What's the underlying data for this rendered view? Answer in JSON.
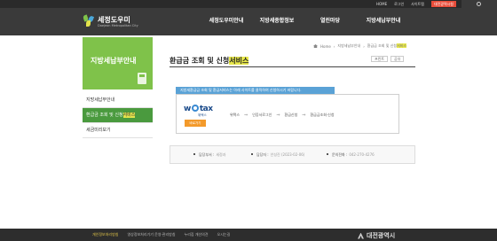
{
  "topbar": {
    "links": [
      "HOME",
      "로그인",
      "사이트맵",
      "대전광역시청"
    ]
  },
  "header": {
    "logo_ko": "세정도우미",
    "logo_en": "Daejeon Metropolitan City",
    "gnb": [
      "세정도우미안내",
      "지방세종합정보",
      "열린마당",
      "지방세납부안내"
    ]
  },
  "sidebar": {
    "title": "지방세납부안내",
    "items": [
      {
        "label": "지방세납부안내"
      },
      {
        "label": "환급금 조회 및 신청",
        "hl": "서비스"
      },
      {
        "label": "세금미리보기"
      }
    ]
  },
  "content": {
    "title": "환급금 조회 및 신청",
    "title_hl": "서비스",
    "breadcrumb": [
      "Home",
      "지방세납부안내",
      "환급금 조회 및 신청",
      "서비스"
    ],
    "tools": [
      "프린트",
      "공유"
    ],
    "notice": "지방세환급금 조회 및 환급서비스는 아래 사이트를 클릭하여 신청하시기 바랍니다.",
    "wetax_logo": "wetax",
    "wetax_sub": "위택스",
    "go_button": "바로가기",
    "flow": [
      "위택스",
      "인증서로그인",
      "환급신청",
      "환급금조회·신청"
    ]
  },
  "info": {
    "dept_label": "담당부서 :",
    "dept_value": "세정과",
    "manager_label": "담당자 :",
    "manager_value": "안성진 (2023-02-06)",
    "phone_label": "문의전화 :",
    "phone_value": "042-270-4276"
  },
  "footer": {
    "links": [
      "개인정보처리방침",
      "영상정보처리기기 운영·관리방침",
      "누리집 개선의견",
      "오시는길"
    ],
    "logo": "대전광역시"
  }
}
